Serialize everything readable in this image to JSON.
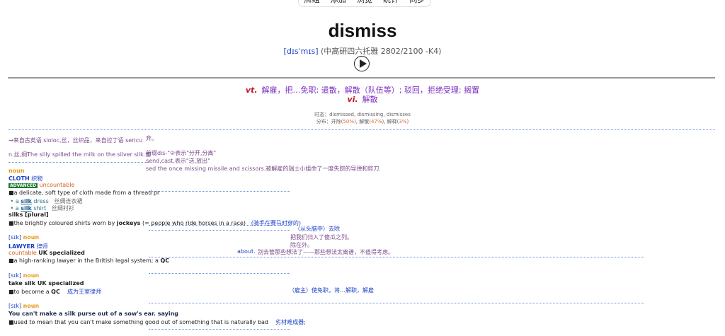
{
  "nav": [
    "牌组",
    "添加",
    "浏览",
    "统计",
    "同步"
  ],
  "word": "dismiss",
  "phonetic": "[dɪsˈmɪs]",
  "levels": "(中高研四六托雅 2802/2100 -K4)",
  "definitions": [
    {
      "pos": "vt.",
      "meaning": "解雇，把…免职; 遣散，解散（队伍等）; 驳回，拒绝受理; 搁置"
    },
    {
      "pos": "vi.",
      "meaning": "解散"
    }
  ],
  "tenses": "时态：dismissed, dismissing, dismisses",
  "dist_prefix": "分布：开除(",
  "dist_v1": "50%",
  "dist_m1": "), 解散(",
  "dist_v2": "47%",
  "dist_m2": "), 解释(",
  "dist_v3": "3%",
  "dist_end": ")",
  "fragments": {
    "etym": "→来自古英语 sioloc,丝，丝织品，来自拉丁语 sericu",
    "etym_r": "弃。",
    "silk_ex": "n.丝,绸The silly spilled the milk on the silver silk.傻",
    "prefix1": "前缀dis-\"②表示\"分开,分离\"",
    "prefix2": "send,cast,表示\"送,放出\"",
    "missile": "sed the once missing missile and scissors.被解雇的瑞士小姐命了一度失踪的导弹和剪刀.",
    "from_head": "（从头脑中）去除",
    "rank1": "把我们归入了傻瓜之列。",
    "rank2": "除在外。",
    "about": "about.",
    "about_cn": "别去管那些想法了——那些想法太离谱，不值得考虑。",
    "cn_left": "（雇主）使免职，将…解职，解雇",
    "jockey_cn": "(骑手在赛马时穿的)",
    "purse_cn": "劣材难成器;"
  },
  "entries": {
    "noun1": "noun",
    "cloth": "CLOTH",
    "cloth_cn": "织物",
    "advanced": "ADVANCED",
    "uncountable": "uncountable",
    "def1": "a delicate, soft type of cloth made from a thread pr",
    "ex1_pre": "a",
    "ex1_word": "silk",
    "ex1_post": "dress",
    "ex1_cn": "丝绸连衣裙",
    "ex2_pre": "a",
    "ex2_word": "silk",
    "ex2_post": "shirt",
    "ex2_cn": "丝绸衬衫",
    "plural": "silks [plural]",
    "def2_a": "the brightly coloured shirts worn by ",
    "def2_b": "jockeys",
    "def2_c": " (= people who ride horses in a race)",
    "pron2": "[sɪk]",
    "noun2": "noun",
    "lawyer": "LAWYER",
    "lawyer_cn": "律师",
    "countable": "countable",
    "uk_spec": "UK specialized",
    "def3_a": "a high-ranking lawyer in the British legal system; a ",
    "def3_b": "QC",
    "pron3": "[sɪk]",
    "noun3": "noun",
    "take_silk": "take silk",
    "take_spec": "UK specialized",
    "def4_a": "to become a ",
    "def4_b": "QC",
    "def4_cn": "成为王室律师",
    "pron4": "[sɪk]",
    "noun4": "noun",
    "purse": "You can't make a silk purse out of a sow's ear.",
    "saying": "saying",
    "def5": "used to mean that you can't make something good out of something that is naturally bad"
  }
}
